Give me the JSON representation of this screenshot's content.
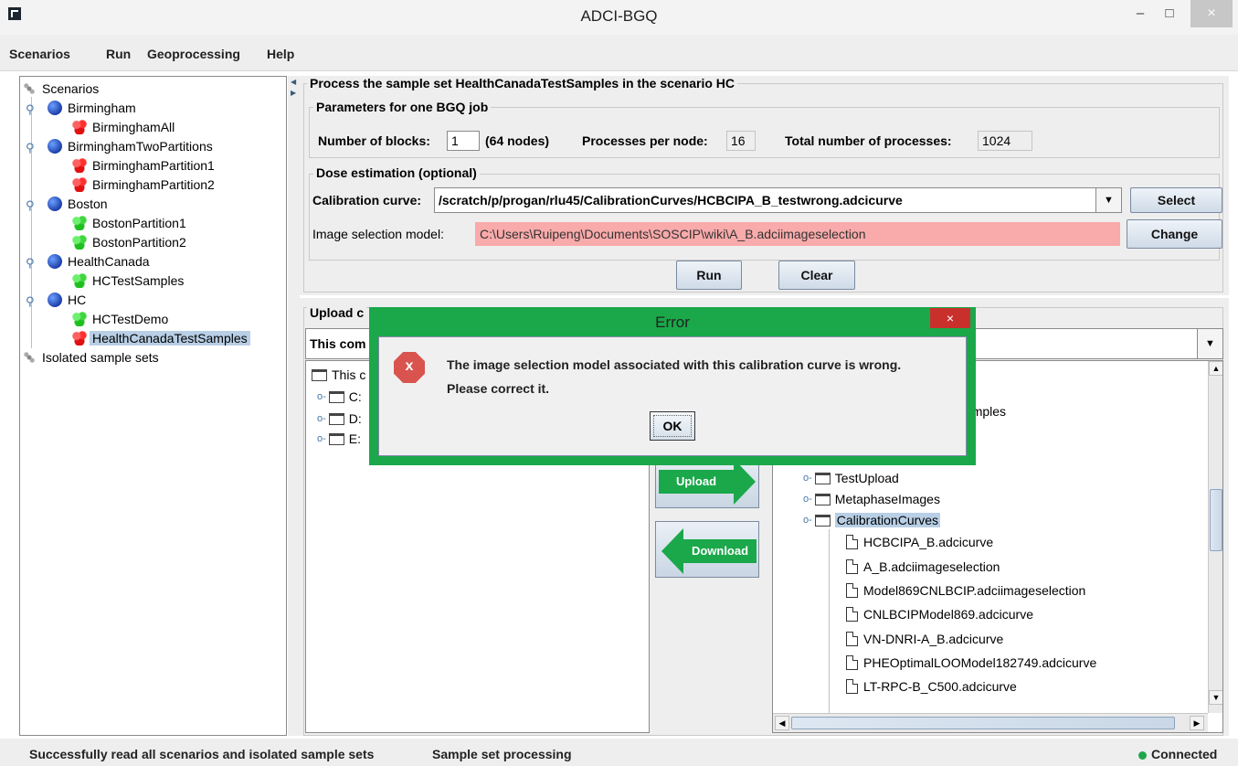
{
  "window": {
    "title": "ADCI-BGQ",
    "minimize": "–",
    "maximize": "□",
    "close": "×"
  },
  "menu": [
    "Scenarios",
    "Run",
    "Geoprocessing",
    "Help"
  ],
  "tree": {
    "root": "Scenarios",
    "scenarios": [
      {
        "name": "Birmingham",
        "children": [
          {
            "name": "BirminghamAll",
            "color": "red"
          }
        ]
      },
      {
        "name": "BirminghamTwoPartitions",
        "children": [
          {
            "name": "BirminghamPartition1",
            "color": "red"
          },
          {
            "name": "BirminghamPartition2",
            "color": "red"
          }
        ]
      },
      {
        "name": "Boston",
        "children": [
          {
            "name": "BostonPartition1",
            "color": "green"
          },
          {
            "name": "BostonPartition2",
            "color": "green"
          }
        ]
      },
      {
        "name": "HealthCanada",
        "children": [
          {
            "name": "HCTestSamples",
            "color": "green"
          }
        ]
      },
      {
        "name": "HC",
        "children": [
          {
            "name": "HCTestDemo",
            "color": "green"
          },
          {
            "name": "HealthCanadaTestSamples",
            "color": "red",
            "selected": true
          }
        ]
      }
    ],
    "isolated": "Isolated sample sets"
  },
  "process": {
    "title": "Process the sample set HealthCanadaTestSamples in the scenario HC",
    "params_title": "Parameters for one BGQ job",
    "blocks_label": "Number of blocks:",
    "blocks_value": "1",
    "nodes_text": "(64 nodes)",
    "ppn_label": "Processes per node:",
    "ppn_value": "16",
    "total_label": "Total number of processes:",
    "total_value": "1024",
    "dose_title": "Dose estimation (optional)",
    "curve_label": "Calibration curve:",
    "curve_value": "/scratch/p/progan/rlu45/CalibrationCurves/HCBCIPA_B_testwrong.adcicurve",
    "select_btn": "Select",
    "model_label": "Image selection model:",
    "model_value": "C:\\Users\\Ruipeng\\Documents\\SOSCIP\\wiki\\A_B.adciimageselection",
    "change_btn": "Change",
    "run_btn": "Run",
    "clear_btn": "Clear"
  },
  "upload": {
    "title": "Upload c",
    "combo_value": "This com",
    "local_root": "This c",
    "drives": [
      "C:",
      "D:",
      "E:"
    ],
    "upload_btn": "Upload",
    "download_btn": "Download",
    "remote_partial": "00Samples",
    "remote_items": [
      {
        "name": "TestUpload",
        "type": "folder"
      },
      {
        "name": "MetaphaseImages",
        "type": "folder"
      },
      {
        "name": "CalibrationCurves",
        "type": "folder",
        "selected": true
      }
    ],
    "files": [
      "HCBCIPA_B.adcicurve",
      "A_B.adciimageselection",
      "Model869CNLBCIP.adciimageselection",
      "CNLBCIPModel869.adcicurve",
      "VN-DNRI-A_B.adcicurve",
      "PHEOptimalLOOModel182749.adcicurve",
      "LT-RPC-B_C500.adcicurve"
    ]
  },
  "status": {
    "message": "Successfully read all scenarios and isolated sample sets",
    "mode": "Sample set processing",
    "connection": "Connected"
  },
  "dialog": {
    "title": "Error",
    "close": "×",
    "icon": "x",
    "line1": "The image selection model associated with this calibration curve is wrong.",
    "line2": "Please correct it.",
    "ok": "OK"
  },
  "colors": {
    "dialog_frame": "#1aa84a",
    "error_field": "#f9aaaa",
    "selection": "#b8cfe5",
    "connected_dot": "#1fa64a"
  }
}
